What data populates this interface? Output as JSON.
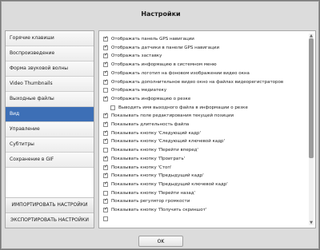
{
  "dialog": {
    "title": "Настройки",
    "ok_label": "OK"
  },
  "sidebar": {
    "items": [
      {
        "label": "Горячие клавиши",
        "active": false
      },
      {
        "label": "Воспроизведение",
        "active": false
      },
      {
        "label": "Форма звуковой волны",
        "active": false
      },
      {
        "label": "Video Thumbnails",
        "active": false
      },
      {
        "label": "Выходные файлы",
        "active": false
      },
      {
        "label": "Вид",
        "active": true
      },
      {
        "label": "Управление",
        "active": false
      },
      {
        "label": "Субтитры",
        "active": false
      },
      {
        "label": "Сохранение в GIF",
        "active": false
      }
    ],
    "import_label": "ИМПОРТИРОВАТЬ НАСТРОЙКИ",
    "export_label": "ЭКСПОРТИРОВАТЬ НАСТРОЙКИ"
  },
  "options": [
    {
      "label": "Отображать панель GPS навигации",
      "checked": true,
      "indent": false
    },
    {
      "label": "Отображать датчики в панели GPS навигации",
      "checked": true,
      "indent": false
    },
    {
      "label": "Отображать заставку",
      "checked": true,
      "indent": false
    },
    {
      "label": "Отображать информацию в системном меню",
      "checked": true,
      "indent": false
    },
    {
      "label": "Отображать логотип на фоновом изображении видео окна",
      "checked": true,
      "indent": false
    },
    {
      "label": "Отображать дополнительное видео окно на файлах видеорегистраторов",
      "checked": true,
      "indent": false
    },
    {
      "label": "Отображать медиатеку",
      "checked": false,
      "indent": false
    },
    {
      "label": "Отображать информацию о резке",
      "checked": true,
      "indent": false
    },
    {
      "label": "Выводить имя выходного файла в информации о резке",
      "checked": false,
      "indent": true
    },
    {
      "label": "Показывать поле редактирования текущей позиции",
      "checked": true,
      "indent": false
    },
    {
      "label": "Показывать длительность файла",
      "checked": true,
      "indent": false
    },
    {
      "label": "Показывать кнопку 'Следующий кадр'",
      "checked": true,
      "indent": false
    },
    {
      "label": "Показывать кнопку 'Следующий ключевой кадр'",
      "checked": true,
      "indent": false
    },
    {
      "label": "Показывать кнопку 'Перейти вперед'",
      "checked": false,
      "indent": false
    },
    {
      "label": "Показывать кнопку 'Проиграть'",
      "checked": true,
      "indent": false
    },
    {
      "label": "Показывать кнопку 'Стоп'",
      "checked": true,
      "indent": false
    },
    {
      "label": "Показывать кнопку 'Предыдущий кадр'",
      "checked": true,
      "indent": false
    },
    {
      "label": "Показывать кнопку 'Предыдущий ключевой кадр'",
      "checked": true,
      "indent": false
    },
    {
      "label": "Показывать кнопку 'Перейти назад'",
      "checked": false,
      "indent": false
    },
    {
      "label": "Показывать регулятор громкости",
      "checked": true,
      "indent": false
    },
    {
      "label": "Показывать кнопку 'Получить скриншот'",
      "checked": true,
      "indent": false
    },
    {
      "label": "",
      "checked": false,
      "indent": false
    }
  ],
  "colors": {
    "accent": "#3d6fb6"
  }
}
